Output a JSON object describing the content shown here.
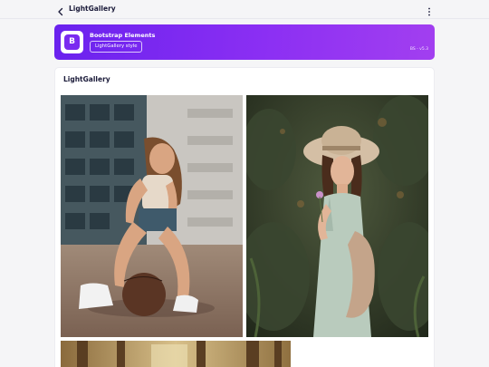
{
  "app": {
    "title": "LightGallery"
  },
  "banner": {
    "logo_letter": "B",
    "title": "Bootstrap Elements",
    "chip_label": "LightGallery style",
    "version": "BS - v5.3"
  },
  "card": {
    "title": "LightGallery"
  },
  "gallery": {
    "items": [
      {
        "name": "gallery-photo-1",
        "depicts": "woman sitting on basketball court"
      },
      {
        "name": "gallery-photo-2",
        "depicts": "woman with sun hat in forest"
      },
      {
        "name": "gallery-photo-3",
        "depicts": "forest"
      }
    ]
  },
  "colors": {
    "banner_start": "#6a22ee",
    "banner_end": "#a23ff0",
    "text_dark": "#1b1b3a",
    "background": "#f5f5f7"
  },
  "icons": {
    "back": "chevron-left-icon",
    "more": "more-vertical-icon",
    "logo": "bootstrap-logo-icon"
  }
}
